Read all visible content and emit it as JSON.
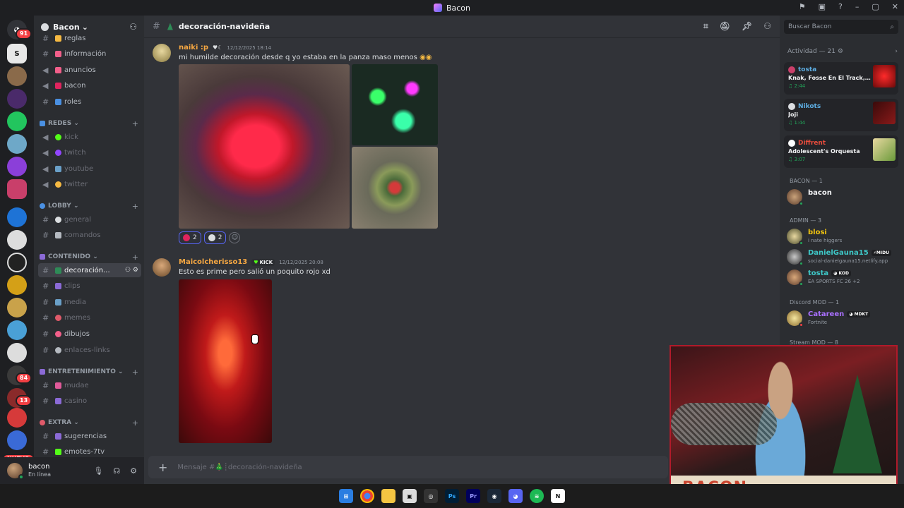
{
  "window": {
    "title": "Bacon"
  },
  "servers": {
    "badges": [
      "91",
      "84",
      "13"
    ],
    "new_label": "NUEVO"
  },
  "guild": {
    "name": "Bacon"
  },
  "channels": {
    "top": [
      {
        "name": "reglas",
        "muted": false
      },
      {
        "name": "información",
        "muted": false
      },
      {
        "name": "anuncios",
        "muted": false
      },
      {
        "name": "bacon",
        "muted": false
      },
      {
        "name": "roles",
        "muted": false
      }
    ],
    "categories": [
      {
        "name": "REDES",
        "items": [
          {
            "name": "kick"
          },
          {
            "name": "twitch"
          },
          {
            "name": "youtube"
          },
          {
            "name": "twitter"
          }
        ]
      },
      {
        "name": "LOBBY",
        "items": [
          {
            "name": "general"
          },
          {
            "name": "comandos"
          }
        ]
      },
      {
        "name": "CONTENIDO",
        "items": [
          {
            "name": "decoración..."
          },
          {
            "name": "clips"
          },
          {
            "name": "media"
          },
          {
            "name": "memes"
          },
          {
            "name": "dibujos"
          },
          {
            "name": "enlaces-links"
          }
        ]
      },
      {
        "name": "ENTRETENIMIENTO",
        "items": [
          {
            "name": "mudae"
          },
          {
            "name": "casino"
          }
        ]
      },
      {
        "name": "EXTRA",
        "items": [
          {
            "name": "sugerencias"
          },
          {
            "name": "emotes-7tv"
          }
        ]
      }
    ]
  },
  "user": {
    "name": "bacon",
    "status": "En línea"
  },
  "channel_header": {
    "name": "decoración-navideña"
  },
  "messages": [
    {
      "author": "naiki :p",
      "timestamp": "12/12/2025 18:14",
      "text": "mi humilde decoración desde q yo estaba en la panza maso menos",
      "reactions": [
        {
          "count": "2",
          "color": "#e0245e"
        },
        {
          "count": "2",
          "color": "#dbdee1"
        }
      ]
    },
    {
      "author": "Maicolcherisso13",
      "tag": "KICK",
      "timestamp": "12/12/2025 20:08",
      "text": "Esto es prime pero salió un poquito rojo xd"
    }
  ],
  "composer": {
    "placeholder": "Mensaje #🎄┊decoración-navideña"
  },
  "search": {
    "placeholder": "Buscar Bacon"
  },
  "activity": {
    "header": "Actividad — 21",
    "cards": [
      {
        "user": "tosta",
        "track": "Knak, Fosse En El Track, O...",
        "time": "2:44",
        "color": "#5dade2"
      },
      {
        "user": "Nikots",
        "track": "Joji",
        "time": "1:44",
        "color": "#5dade2"
      },
      {
        "user": "Diffrent",
        "track": "Adolescent's Orquesta",
        "time": "3:07",
        "color": "#e74c3c"
      }
    ]
  },
  "members": {
    "groups": [
      {
        "role": "BACON — 1",
        "members": [
          {
            "name": "bacon",
            "status": "",
            "badge": "",
            "color": "#f2f3f5"
          }
        ]
      },
      {
        "role": "ADMIN — 3",
        "members": [
          {
            "name": "blosi",
            "status": "i nate higgers",
            "badge": "",
            "color": "#f1c40f"
          },
          {
            "name": "DanielGauna15",
            "status": "social-danielgauna15.netlify.app",
            "badge": "MIDU",
            "color": "#3ec8c8"
          },
          {
            "name": "tosta",
            "status": "EA SPORTS FC 26 +2",
            "badge": "KOD",
            "color": "#3ec8c8"
          }
        ]
      },
      {
        "role": "Discord MOD — 1",
        "members": [
          {
            "name": "Catareen",
            "status": "Fortnite",
            "badge": "MDKT",
            "color": "#a970ff"
          }
        ]
      },
      {
        "role": "Stream MOD — 8",
        "members": []
      }
    ]
  },
  "webcam": {
    "banner": "BACON"
  },
  "colors": {
    "accent": "#5865f2",
    "online": "#23a55a",
    "danger": "#f23f43"
  }
}
